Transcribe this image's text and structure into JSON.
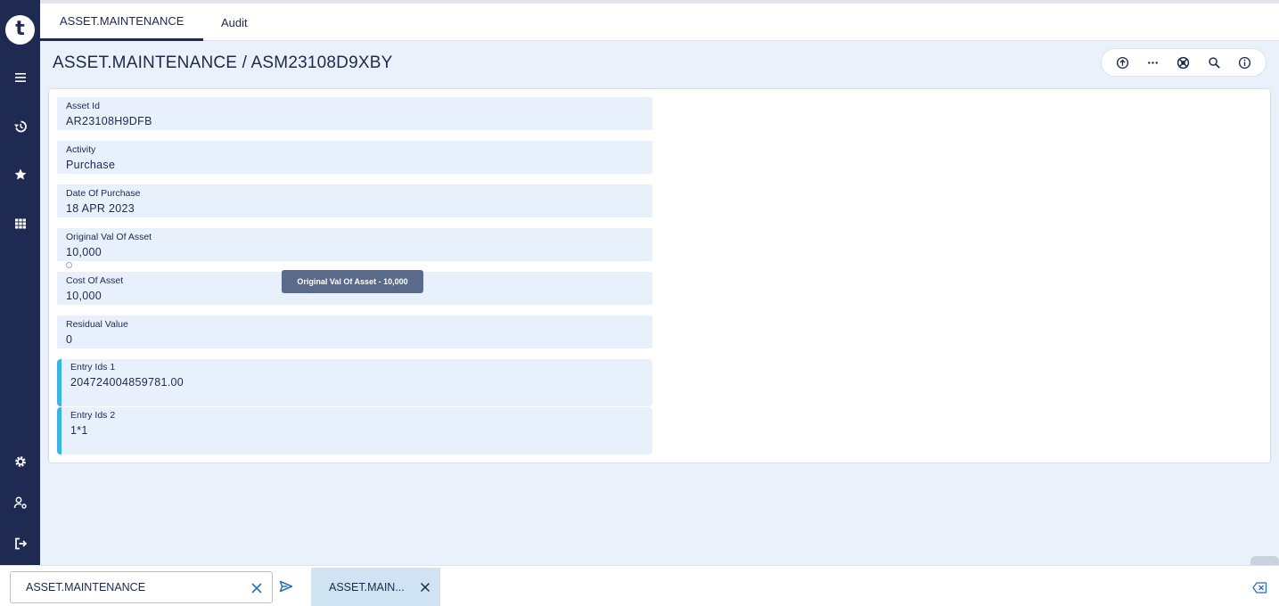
{
  "app": {
    "logo_letter": "t"
  },
  "sidebar": {
    "items": [
      {
        "icon": "menu-icon"
      },
      {
        "icon": "history-icon"
      },
      {
        "icon": "star-icon"
      },
      {
        "icon": "grid-icon"
      },
      {
        "icon": "settings-icon"
      },
      {
        "icon": "user-settings-icon"
      },
      {
        "icon": "logout-icon"
      }
    ]
  },
  "tabs": [
    {
      "label": "ASSET.MAINTENANCE",
      "active": true
    },
    {
      "label": "Audit",
      "active": false
    }
  ],
  "page": {
    "title": "ASSET.MAINTENANCE / ASM23108D9XBY"
  },
  "toolbar": {
    "icons": [
      "upload-icon",
      "more-icon",
      "globe-icon",
      "search-icon",
      "info-icon"
    ]
  },
  "fields": [
    {
      "label": "Asset Id",
      "value": "AR23108H9DFB"
    },
    {
      "label": "Activity",
      "value": "Purchase"
    },
    {
      "label": "Date Of Purchase",
      "value": "18 APR 2023"
    },
    {
      "label": "Original Val Of Asset",
      "value": "10,000"
    },
    {
      "label": "Cost Of Asset",
      "value": "10,000"
    },
    {
      "label": "Residual Value",
      "value": "0"
    },
    {
      "label": "Entry Ids 1",
      "value": "204724004859781.00"
    },
    {
      "label": "Entry Ids 2",
      "value": "1*1"
    }
  ],
  "tooltip": {
    "text": "Original Val Of Asset - 10,000"
  },
  "bottom": {
    "command_value": "ASSET.MAINTENANCE",
    "open_tab_label": "ASSET.MAIN..."
  },
  "colors": {
    "sidebar": "#1e2a52",
    "accent": "#3ab4e4",
    "field_bg": "#e8f0fc",
    "main_bg": "#eaf1fb"
  }
}
